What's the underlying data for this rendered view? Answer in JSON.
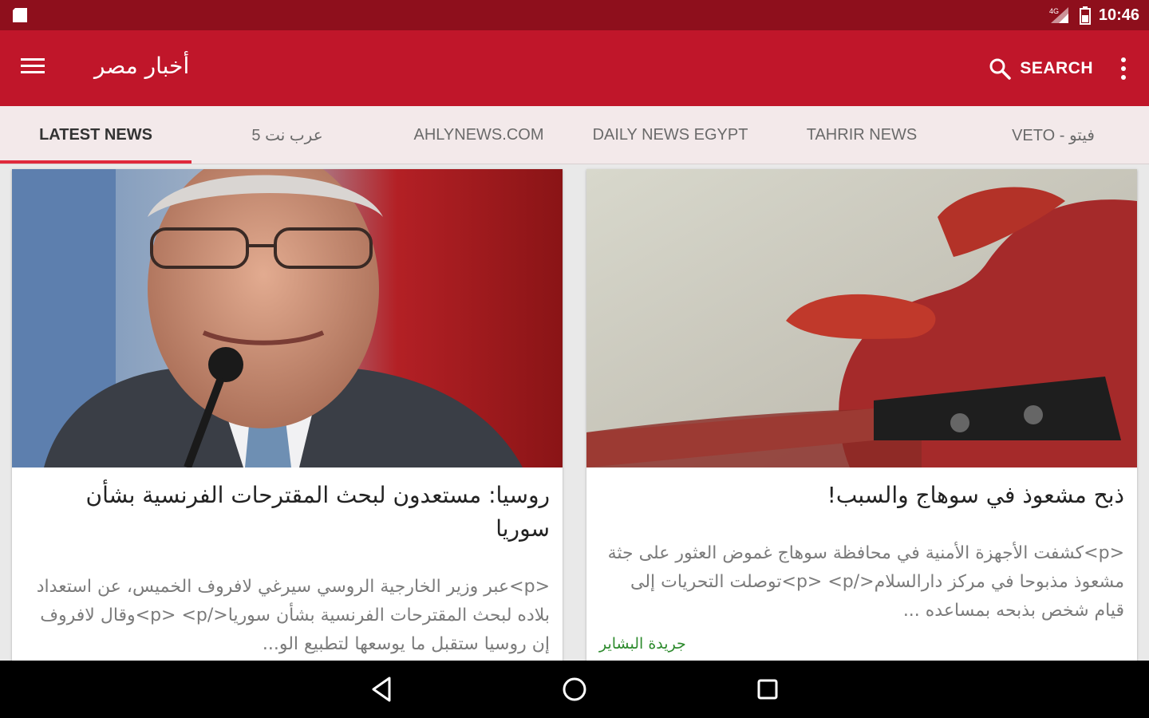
{
  "status_bar": {
    "time": "10:46"
  },
  "app_bar": {
    "title": "أخبار مصر",
    "search_label": "SEARCH"
  },
  "tabs": [
    {
      "label": "LATEST NEWS",
      "active": true
    },
    {
      "label": "5 عرب نت",
      "active": false
    },
    {
      "label": "AHLYNEWS.COM",
      "active": false
    },
    {
      "label": "DAILY NEWS EGYPT",
      "active": false
    },
    {
      "label": "TAHRIR NEWS",
      "active": false
    },
    {
      "label": "VETO - فيتو",
      "active": false
    }
  ],
  "articles": [
    {
      "title": "روسيا: مستعدون لبحث المقترحات الفرنسية بشأن سوريا",
      "summary": "<p>عبر وزير الخارجية الروسي سيرغي لافروف الخميس، عن استعداد بلاده لبحث المقترحات الفرنسية بشأن سوريا</p> <p>وقال لافروف إن روسيا ستقبل ما يوسعها لتطبيع الو...",
      "source": ""
    },
    {
      "title": "ذبح مشعوذ في سوهاج والسبب!",
      "summary": "<p>كشفت الأجهزة الأمنية في محافظة سوهاج غموض العثور على جثة مشعوذ مذبوحا في مركز دارالسلام</p> <p>توصلت التحريات إلى قيام شخص بذبحه بمساعده ...",
      "source": "جريدة البشاير"
    }
  ],
  "colors": {
    "status_bar": "#8e0f1c",
    "app_bar": "#c0162a",
    "tab_strip": "#f3e9ea",
    "tab_indicator": "#e02a3c",
    "source_text": "#2e8b2e"
  },
  "icons": {
    "menu": "hamburger-icon",
    "search": "search-icon",
    "overflow": "more-vert-icon",
    "back": "back-icon",
    "home": "home-icon",
    "recents": "recents-icon"
  }
}
